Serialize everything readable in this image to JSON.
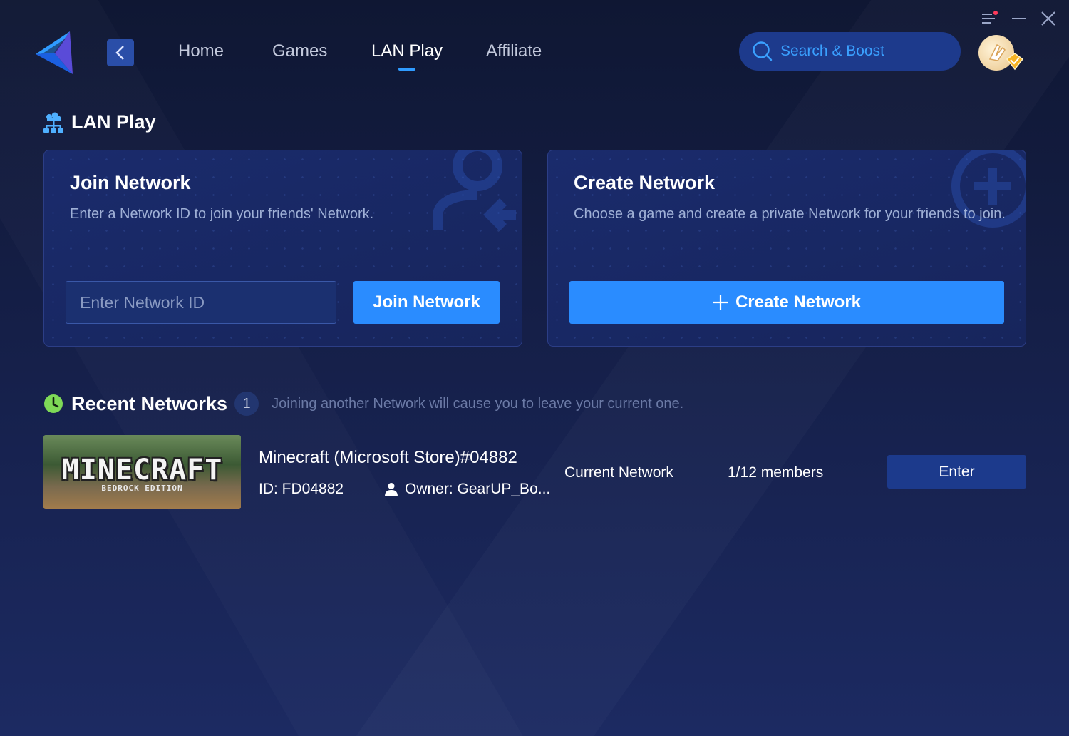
{
  "nav": {
    "items": [
      {
        "label": "Home",
        "active": false
      },
      {
        "label": "Games",
        "active": false
      },
      {
        "label": "LAN Play",
        "active": true
      },
      {
        "label": "Affiliate",
        "active": false
      }
    ]
  },
  "search": {
    "placeholder": "Search & Boost"
  },
  "page": {
    "title": "LAN Play"
  },
  "join_card": {
    "title": "Join Network",
    "description": "Enter a Network ID to join your friends' Network.",
    "input_placeholder": "Enter Network ID",
    "button_label": "Join Network"
  },
  "create_card": {
    "title": "Create Network",
    "description": "Choose a game and create a private Network for your friends to join.",
    "button_label": "Create Network"
  },
  "recent": {
    "title": "Recent Networks",
    "count": "1",
    "note": "Joining another Network will cause you to leave your current one.",
    "items": [
      {
        "thumb_title": "MINECRAFT",
        "thumb_subtitle": "BEDROCK EDITION",
        "name": "Minecraft (Microsoft Store)#04882",
        "id": "ID: FD04882",
        "owner": "Owner: GearUP_Bo...",
        "status": "Current Network",
        "members": "1/12 members",
        "button_label": "Enter"
      }
    ]
  },
  "colors": {
    "accent": "#2a8cff",
    "nav_indicator": "#2f9bff",
    "clock_icon": "#7ed957",
    "search_text": "#3aa0ff"
  }
}
